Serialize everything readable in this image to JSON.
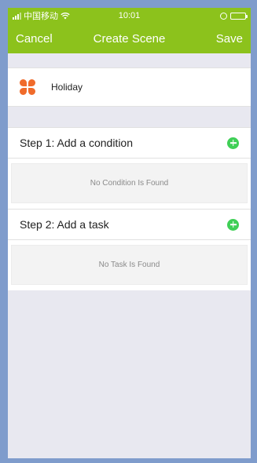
{
  "status_bar": {
    "carrier": "中国移动",
    "time": "10:01"
  },
  "nav": {
    "cancel_label": "Cancel",
    "title": "Create Scene",
    "save_label": "Save"
  },
  "scene": {
    "icon": "scene-icon",
    "name": "Holiday"
  },
  "step1": {
    "label": "Step 1: Add a condition",
    "empty_text": "No Condition Is Found"
  },
  "step2": {
    "label": "Step 2: Add a task",
    "empty_text": "No Task Is Found"
  },
  "colors": {
    "brand": "#8cc21c",
    "scene_icon": "#f06b2b",
    "add_button": "#3fcf56"
  }
}
